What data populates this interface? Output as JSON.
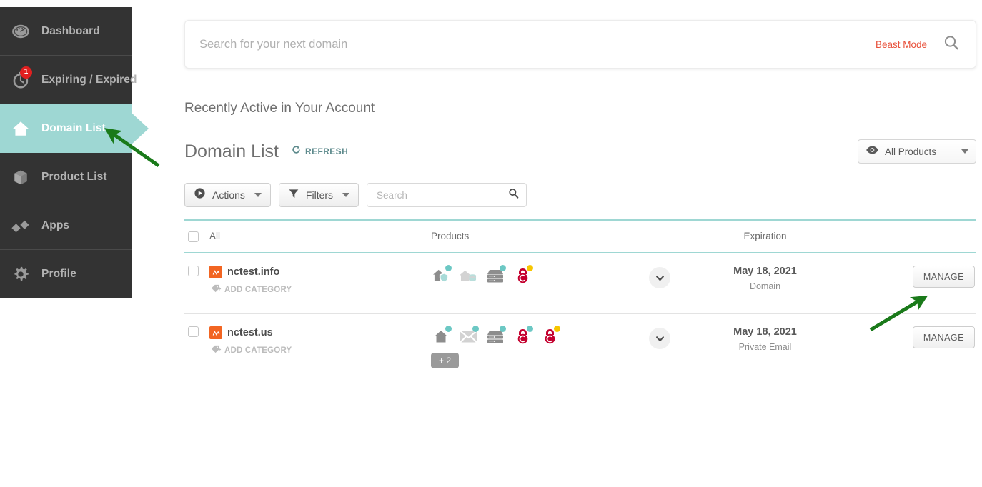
{
  "sidebar": {
    "items": [
      {
        "label": "Dashboard",
        "icon": "gauge-icon",
        "active": false,
        "badge": null
      },
      {
        "label": "Expiring / Expired",
        "icon": "stopwatch-icon",
        "active": false,
        "badge": "1"
      },
      {
        "label": "Domain List",
        "icon": "house-icon",
        "active": true,
        "badge": null
      },
      {
        "label": "Product List",
        "icon": "box-icon",
        "active": false,
        "badge": null
      },
      {
        "label": "Apps",
        "icon": "diamonds-icon",
        "active": false,
        "badge": null
      },
      {
        "label": "Profile",
        "icon": "gear-icon",
        "active": false,
        "badge": null
      }
    ]
  },
  "hero_search": {
    "placeholder": "Search for your next domain",
    "value": "",
    "beast_mode_label": "Beast Mode",
    "search_icon": "search-icon"
  },
  "section": {
    "subtitle": "Recently Active in Your Account",
    "title": "Domain List",
    "refresh_label": "REFRESH",
    "refresh_icon": "refresh-icon"
  },
  "products_filter": {
    "label": "All Products",
    "icon": "eye-icon",
    "caret": "chevron-down-icon"
  },
  "toolbar": {
    "actions_label": "Actions",
    "actions_icon": "play-circle-icon",
    "filters_label": "Filters",
    "filters_icon": "funnel-icon",
    "search_placeholder": "Search",
    "search_value": "",
    "search_icon": "search-icon"
  },
  "table": {
    "headers": {
      "all": "All",
      "products": "Products",
      "expiration": "Expiration"
    },
    "rows": [
      {
        "domain": "nctest.info",
        "logo": "namecheap-logo",
        "add_category_label": "ADD CATEGORY",
        "add_category_icon": "tag-plus-icon",
        "products": [
          {
            "icon": "domain-shield-icon",
            "dot": "teal"
          },
          {
            "icon": "hosting-house-icon",
            "dot": "none"
          },
          {
            "icon": "server-icon",
            "dot": "teal"
          },
          {
            "icon": "ssl-lock-icon",
            "dot": "yellow"
          }
        ],
        "extra_products": null,
        "expiration_date": "May 18, 2021",
        "expiration_type": "Domain",
        "manage_label": "MANAGE",
        "expand_icon": "chevron-down-icon"
      },
      {
        "domain": "nctest.us",
        "logo": "namecheap-logo",
        "add_category_label": "ADD CATEGORY",
        "add_category_icon": "tag-plus-icon",
        "products": [
          {
            "icon": "domain-house-icon",
            "dot": "teal"
          },
          {
            "icon": "email-envelope-icon",
            "dot": "teal"
          },
          {
            "icon": "server-icon",
            "dot": "teal"
          },
          {
            "icon": "ssl-lock-icon",
            "dot": "teal"
          },
          {
            "icon": "ssl-lock-icon",
            "dot": "yellow"
          }
        ],
        "extra_products": "+ 2",
        "expiration_date": "May 18, 2021",
        "expiration_type": "Private Email",
        "manage_label": "MANAGE",
        "expand_icon": "chevron-down-icon"
      }
    ]
  },
  "colors": {
    "accent_teal": "#9ed7d3",
    "sidebar_dark": "#333333",
    "brand_orange": "#f26522",
    "beast_red": "#e8503a",
    "badge_red": "#e02020",
    "dot_teal": "#6cc8c4",
    "dot_yellow": "#f7c600",
    "annotation_green": "#1a7a1a"
  },
  "annotations": [
    {
      "name": "arrow-to-domain-list",
      "color": "#1a7a1a"
    },
    {
      "name": "arrow-to-manage-button",
      "color": "#1a7a1a"
    }
  ]
}
